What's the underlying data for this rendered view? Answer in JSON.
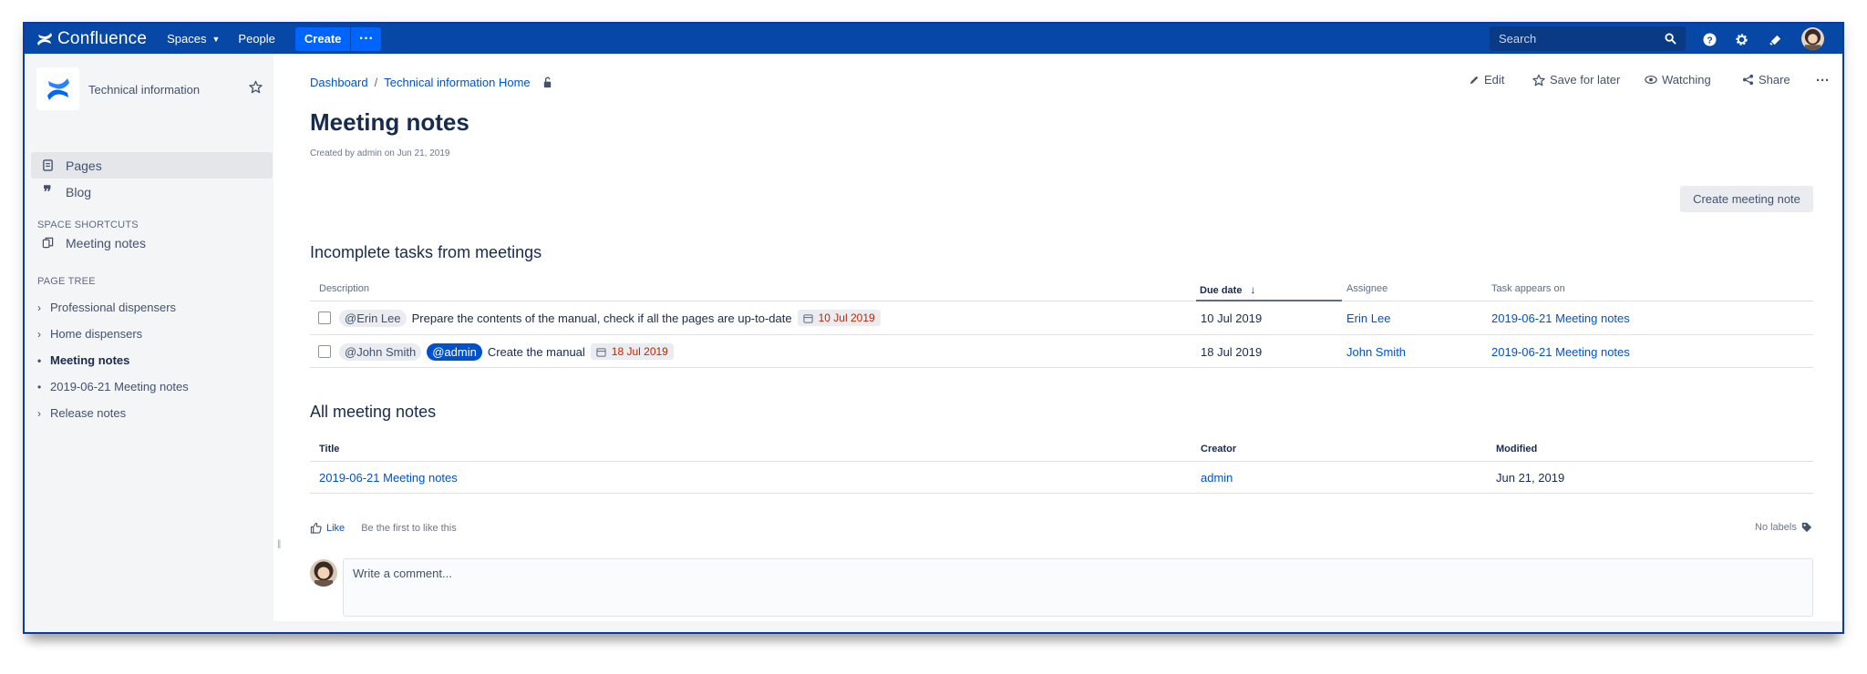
{
  "topnav": {
    "logo_text": "Confluence",
    "spaces": "Spaces",
    "people": "People",
    "create": "Create",
    "more": "···",
    "search_placeholder": "Search"
  },
  "sidebar": {
    "space_name": "Technical information",
    "items": [
      {
        "label": "Pages",
        "icon": "pages-icon"
      },
      {
        "label": "Blog",
        "icon": "blog-quote-icon"
      }
    ],
    "shortcuts_heading": "SPACE SHORTCUTS",
    "shortcut": "Meeting notes",
    "tree_heading": "PAGE TREE",
    "tree": [
      {
        "label": "Professional dispensers",
        "marker": "›"
      },
      {
        "label": "Home dispensers",
        "marker": "›"
      },
      {
        "label": "Meeting notes",
        "marker": "•"
      },
      {
        "label": "2019-06-21 Meeting notes",
        "marker": "•"
      },
      {
        "label": "Release notes",
        "marker": "›"
      }
    ]
  },
  "page": {
    "breadcrumb": [
      "Dashboard",
      "Technical information Home"
    ],
    "breadcrumb_separator": "/",
    "actions": {
      "edit": "Edit",
      "save": "Save for later",
      "watching": "Watching",
      "share": "Share",
      "more": "···"
    },
    "title": "Meeting notes",
    "byline": "Created by admin on Jun 21, 2019",
    "create_button": "Create meeting note"
  },
  "tasks": {
    "heading": "Incomplete tasks from meetings",
    "columns": {
      "description": "Description",
      "due": "Due date",
      "assignee": "Assignee",
      "appears": "Task appears on"
    },
    "rows": [
      {
        "mention": "@Erin Lee",
        "text": "Prepare the contents of the manual, check if all the pages are up-to-date",
        "lozenge": "10 Jul 2019",
        "due": "10 Jul 2019",
        "assignee": "Erin Lee",
        "appears": "2019-06-21 Meeting notes"
      },
      {
        "mention": "@John Smith",
        "mention2": "@admin",
        "text": "Create the manual",
        "lozenge": "18 Jul 2019",
        "due": "18 Jul 2019",
        "assignee": "John Smith",
        "appears": "2019-06-21 Meeting notes"
      }
    ]
  },
  "notes": {
    "heading": "All meeting notes",
    "columns": {
      "title": "Title",
      "creator": "Creator",
      "modified": "Modified"
    },
    "rows": [
      {
        "title": "2019-06-21 Meeting notes",
        "creator": "admin",
        "modified": "Jun 21, 2019"
      }
    ]
  },
  "footer": {
    "like": "Like",
    "first_like": "Be the first to like this",
    "labels": "No labels",
    "comment_placeholder": "Write a comment..."
  },
  "colors": {
    "nav": "#0747a6",
    "link": "#0052cc",
    "create": "#0065ff",
    "overdue": "#bf2600"
  }
}
